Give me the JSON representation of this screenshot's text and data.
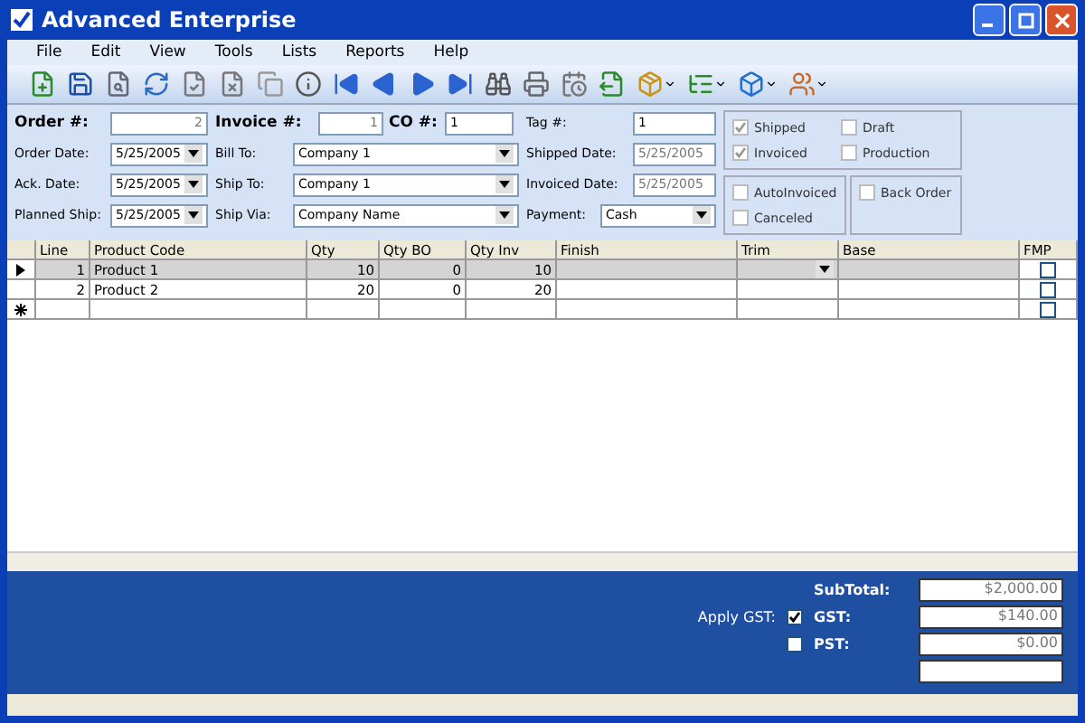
{
  "window": {
    "title": "Advanced Enterprise"
  },
  "menu": [
    "File",
    "Edit",
    "View",
    "Tools",
    "Lists",
    "Reports",
    "Help"
  ],
  "header": {
    "order_no": {
      "label": "Order #:",
      "value": "2"
    },
    "invoice_no": {
      "label": "Invoice #:",
      "value": "1"
    },
    "co_no": {
      "label": "CO #:",
      "value": "1"
    },
    "tag_no": {
      "label": "Tag #:",
      "value": "1"
    }
  },
  "dates": [
    {
      "label": "Order Date:",
      "value": "5/25/2005"
    },
    {
      "label": "Ack. Date:",
      "value": "5/25/2005"
    },
    {
      "label": "Planned Ship:",
      "value": "5/25/2005"
    }
  ],
  "addresses": [
    {
      "label": "Bill To:",
      "value": "Company 1"
    },
    {
      "label": "Ship To:",
      "value": "Company 1"
    },
    {
      "label": "Ship Via:",
      "value": "Company Name"
    }
  ],
  "status_dates": [
    {
      "label": "Shipped Date:",
      "value": "5/25/2005",
      "disabled": true
    },
    {
      "label": "Invoiced Date:",
      "value": "5/25/2005",
      "disabled": true
    }
  ],
  "payment": {
    "label": "Payment:",
    "value": "Cash"
  },
  "flags_top": [
    {
      "label": "Shipped",
      "checked": true,
      "disabled": true
    },
    {
      "label": "Draft",
      "checked": false,
      "disabled": true
    },
    {
      "label": "Invoiced",
      "checked": true,
      "disabled": true
    },
    {
      "label": "Production",
      "checked": false,
      "disabled": true
    }
  ],
  "flags_bottom": [
    {
      "label": "AutoInvoiced",
      "checked": false,
      "disabled": true
    },
    {
      "label": "Canceled",
      "checked": false,
      "disabled": true
    }
  ],
  "flags_side": [
    {
      "label": "Back Order",
      "checked": false,
      "disabled": true
    }
  ],
  "table": {
    "columns": [
      "Line",
      "Product Code",
      "Qty",
      "Qty BO",
      "Qty Inv",
      "Finish",
      "Trim",
      "Base",
      "FMP"
    ],
    "rows": [
      {
        "selected": true,
        "cells": [
          "1",
          "Product 1",
          "10",
          "0",
          "10",
          "",
          "",
          "",
          ""
        ],
        "fmp": false
      },
      {
        "selected": false,
        "cells": [
          "2",
          "Product 2",
          "20",
          "0",
          "20",
          "",
          "",
          "",
          ""
        ],
        "fmp": false
      }
    ]
  },
  "totals": [
    {
      "label": "SubTotal:",
      "value": "$2,000.00"
    },
    {
      "apply_label": "Apply GST:",
      "apply_checked": true,
      "label": "GST:",
      "value": "$140.00"
    },
    {
      "apply_checked": false,
      "label": "PST:",
      "value": "$0.00"
    }
  ],
  "new_row": {
    "fmp": false
  }
}
